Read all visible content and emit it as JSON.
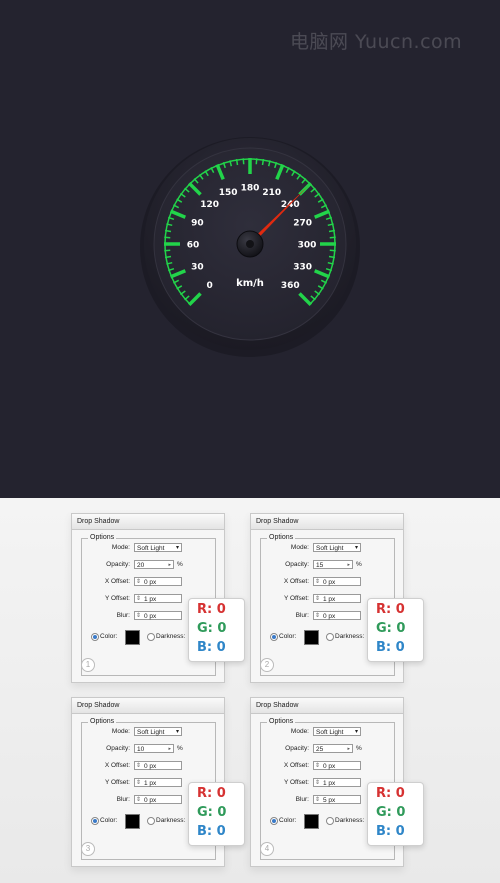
{
  "watermark": "电脑网 Yuucn.com",
  "gauge": {
    "tick_labels": [
      "0",
      "30",
      "60",
      "90",
      "120",
      "150",
      "180",
      "210",
      "240",
      "270",
      "300",
      "330",
      "360"
    ],
    "unit": "km/h",
    "min": 0,
    "max": 360,
    "needle_value": 240,
    "colors": {
      "background": "#24232f",
      "dial": "#2a2a36",
      "ticks": "#22d44a",
      "needle": "#e02a10",
      "labels": "#ffffff"
    }
  },
  "panels": [
    {
      "title": "Drop Shadow",
      "options_label": "Options",
      "mode_label": "Mode:",
      "mode": "Soft Light",
      "opacity_label": "Opacity:",
      "opacity": "20",
      "opacity_unit": "%",
      "xoffset_label": "X Offset:",
      "xoffset": "0 px",
      "yoffset_label": "Y Offset:",
      "yoffset": "1 px",
      "blur_label": "Blur:",
      "blur": "0 px",
      "color_label": "Color:",
      "darkness_label": "Darkness:",
      "step": "1",
      "r": "R: 0",
      "g": "G: 0",
      "b": "B: 0"
    },
    {
      "title": "Drop Shadow",
      "options_label": "Options",
      "mode_label": "Mode:",
      "mode": "Soft Light",
      "opacity_label": "Opacity:",
      "opacity": "15",
      "opacity_unit": "%",
      "xoffset_label": "X Offset:",
      "xoffset": "0 px",
      "yoffset_label": "Y Offset:",
      "yoffset": "1 px",
      "blur_label": "Blur:",
      "blur": "0 px",
      "color_label": "Color:",
      "darkness_label": "Darkness:",
      "step": "2",
      "r": "R: 0",
      "g": "G: 0",
      "b": "B: 0"
    },
    {
      "title": "Drop Shadow",
      "options_label": "Options",
      "mode_label": "Mode:",
      "mode": "Soft Light",
      "opacity_label": "Opacity:",
      "opacity": "10",
      "opacity_unit": "%",
      "xoffset_label": "X Offset:",
      "xoffset": "0 px",
      "yoffset_label": "Y Offset:",
      "yoffset": "1 px",
      "blur_label": "Blur:",
      "blur": "0 px",
      "color_label": "Color:",
      "darkness_label": "Darkness:",
      "step": "3",
      "r": "R: 0",
      "g": "G: 0",
      "b": "B: 0"
    },
    {
      "title": "Drop Shadow",
      "options_label": "Options",
      "mode_label": "Mode:",
      "mode": "Soft Light",
      "opacity_label": "Opacity:",
      "opacity": "25",
      "opacity_unit": "%",
      "xoffset_label": "X Offset:",
      "xoffset": "0 px",
      "yoffset_label": "Y Offset:",
      "yoffset": "1 px",
      "blur_label": "Blur:",
      "blur": "5 px",
      "color_label": "Color:",
      "darkness_label": "Darkness:",
      "step": "4",
      "r": "R: 0",
      "g": "G: 0",
      "b": "B: 0"
    }
  ]
}
